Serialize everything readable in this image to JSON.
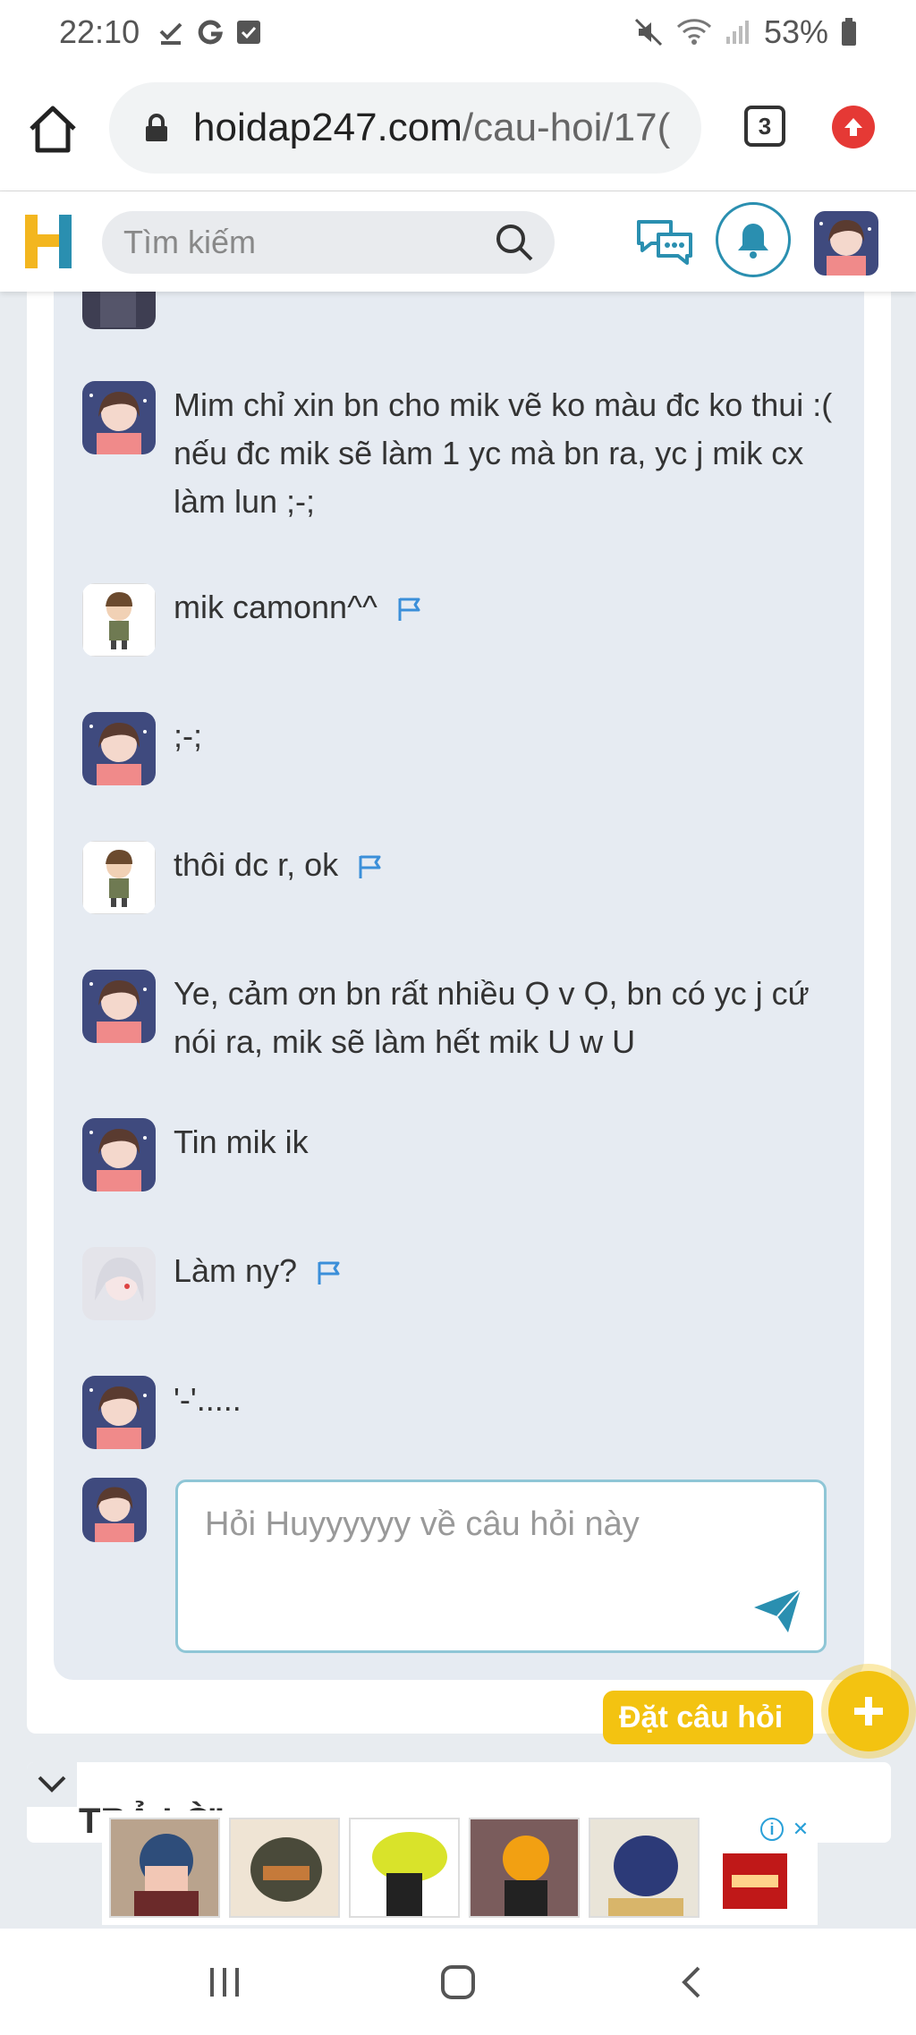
{
  "status_bar": {
    "time": "22:10",
    "left_icons": [
      "check-icon",
      "g-icon",
      "checkbox-icon"
    ],
    "battery": "53%",
    "right_icons": [
      "mute-icon",
      "wifi-icon",
      "signal-icon",
      "battery-icon"
    ]
  },
  "browser": {
    "url_host": "hoidap247.com",
    "url_path": "/cau-hoi/17(",
    "tab_count": "3"
  },
  "site_header": {
    "search_placeholder": "Tìm kiếm"
  },
  "thread": {
    "messages": [
      {
        "text": "Mim chỉ xin bn cho mik vẽ ko màu đc ko thui :( nếu đc mik sẽ làm 1 yc mà bn ra, yc j mik cx làm lun ;-;",
        "avatar": "anime-girl",
        "flag": false
      },
      {
        "text": "mik camonn^^",
        "avatar": "chibi-boy",
        "flag": true
      },
      {
        "text": ";-;",
        "avatar": "anime-girl",
        "flag": false
      },
      {
        "text": "thôi dc r, ok",
        "avatar": "chibi-boy",
        "flag": true
      },
      {
        "text": "Ye, cảm ơn bn rất nhiều Ọ v Ọ, bn có yc j cứ nói ra, mik sẽ làm hết mik U w U",
        "avatar": "anime-girl",
        "flag": false
      },
      {
        "text": "Tin mik ik",
        "avatar": "anime-girl",
        "flag": false
      },
      {
        "text": "Làm ny?",
        "avatar": "white-hair",
        "flag": true
      },
      {
        "text": "'-'.....",
        "avatar": "anime-girl",
        "flag": false
      }
    ],
    "reply_placeholder": "Hỏi Huyyyyyy về câu hỏi này"
  },
  "ask_button_label": "Đặt câu hỏi",
  "answer_section_title": "TRẢ LỜI",
  "colors": {
    "brand_yellow": "#f3c311",
    "accent_blue": "#2a8fb0",
    "flag_blue": "#3b8fd9",
    "thread_bg": "#e6ebf2"
  }
}
